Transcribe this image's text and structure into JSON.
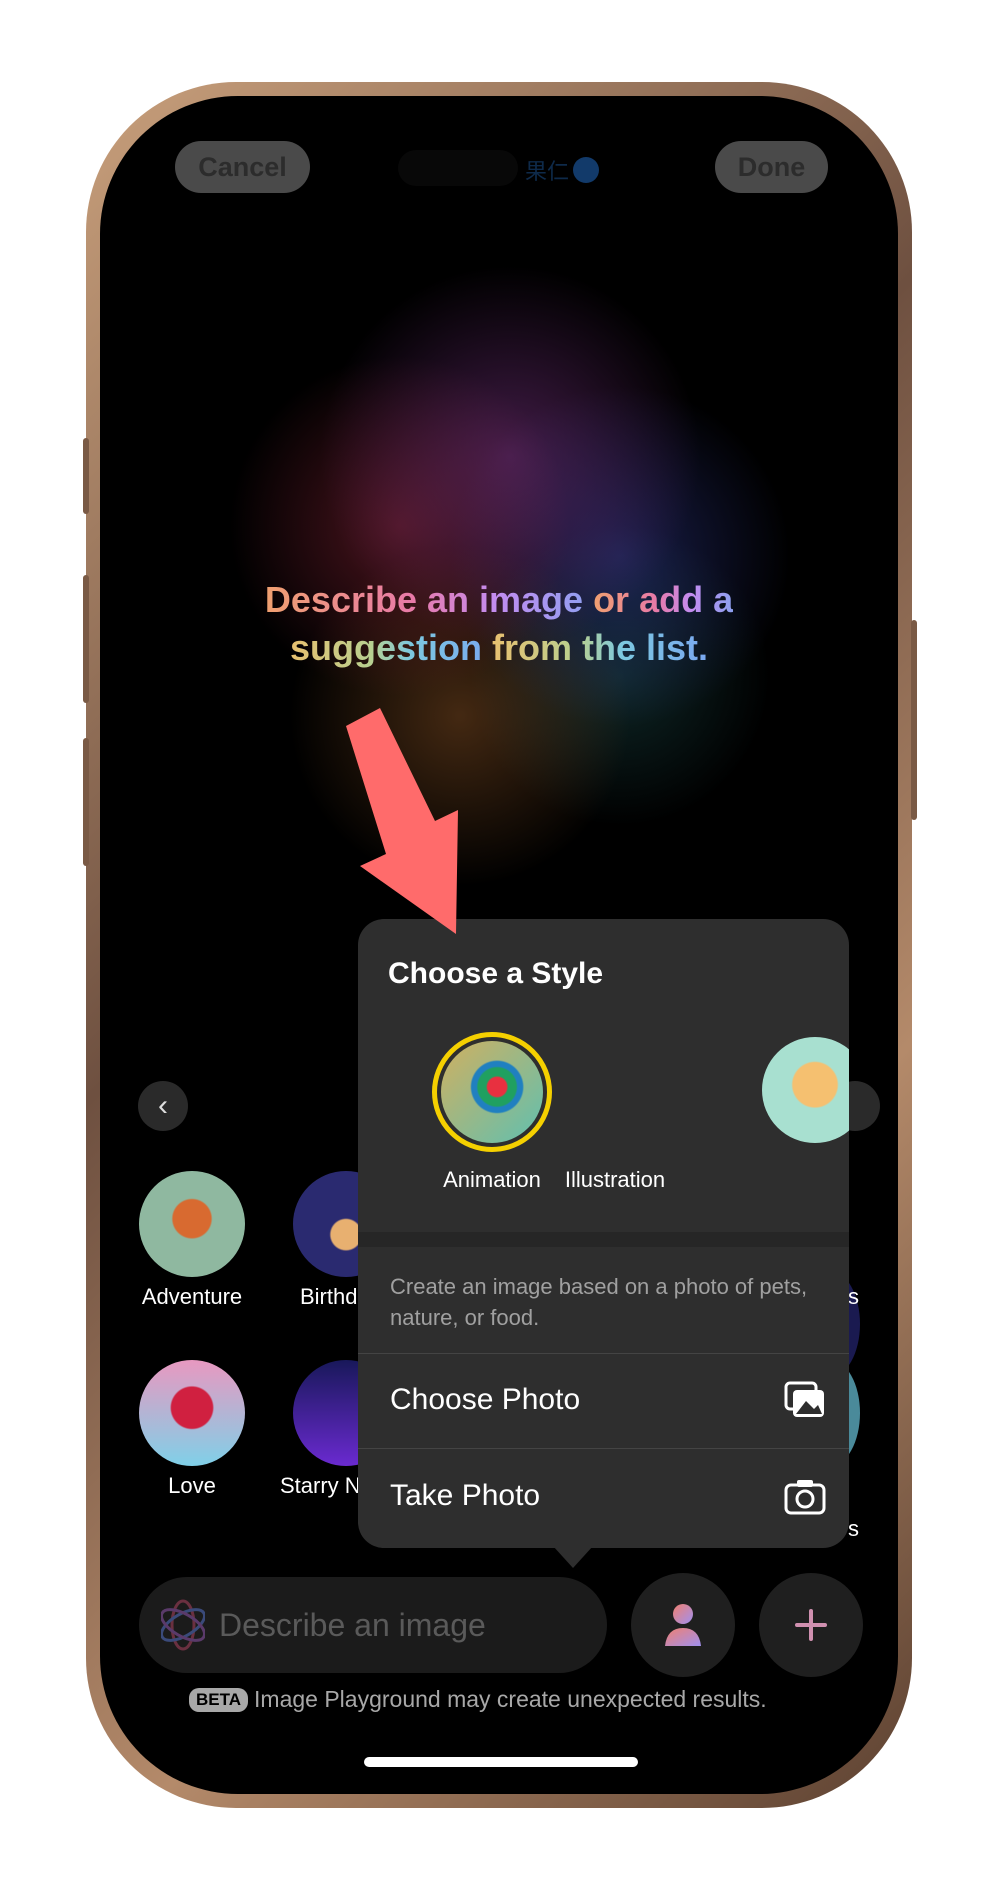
{
  "header": {
    "cancel_label": "Cancel",
    "done_label": "Done",
    "status_text": "果仁"
  },
  "prompt": {
    "line1_a": "Describe an image ",
    "line1_b": "or add a",
    "line2_a": "suggestion ",
    "line2_b": "from the list."
  },
  "annotation": {
    "arrow_color": "#ff6b6b"
  },
  "suggestions": [
    {
      "label": "Adventure"
    },
    {
      "label": "Birthday",
      "visible": "Birthd"
    },
    {
      "label": "Love"
    },
    {
      "label": "Starry Night",
      "visible": "Starry N"
    }
  ],
  "suggestions_right_partial": [
    "s",
    "s"
  ],
  "popover": {
    "title": "Choose a Style",
    "styles": [
      {
        "label": "Animation",
        "selected": true
      },
      {
        "label": "Illustration",
        "selected": false
      }
    ],
    "description": "Create an image based on a photo of pets, nature, or food.",
    "items": [
      {
        "label": "Choose Photo",
        "icon": "photo-library-icon"
      },
      {
        "label": "Take Photo",
        "icon": "camera-icon"
      }
    ]
  },
  "input": {
    "placeholder": "Describe an image"
  },
  "footer": {
    "badge": "BETA",
    "text": "Image Playground may create unexpected results."
  },
  "colors": {
    "selection_ring": "#f5d000",
    "popover_bg": "#2e2e2e"
  }
}
